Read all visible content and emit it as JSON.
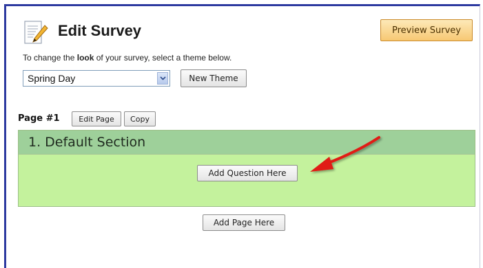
{
  "header": {
    "title": "Edit Survey",
    "icon": "edit-document-icon"
  },
  "preview_button": {
    "label": "Preview Survey"
  },
  "theme": {
    "instruction_prefix": "To change the ",
    "instruction_bold": "look",
    "instruction_suffix": " of your survey, select a theme below.",
    "selected": "Spring Day",
    "new_theme_label": "New Theme"
  },
  "page": {
    "label": "Page #1",
    "edit_page_label": "Edit Page",
    "copy_label": "Copy"
  },
  "section": {
    "title": "1. Default Section",
    "add_question_label": "Add Question Here"
  },
  "add_page_label": "Add Page Here",
  "colors": {
    "section_body": "#c4f29d",
    "section_header": "#9ed09a",
    "preview_button": "#f7c873",
    "frame_border": "#2d3aa0",
    "arrow": "#e01b12"
  }
}
